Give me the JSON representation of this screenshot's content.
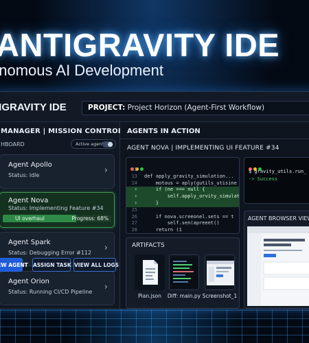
{
  "hero": {
    "title": "ANTIGRAVITY IDE",
    "subtitle": "onomous AI Development"
  },
  "ide": {
    "logo": "TIGRAVITY IDE",
    "project_label": "PROJECT:",
    "project_value": "Project Horizon (Agent-First Workflow)"
  },
  "left_panel": {
    "title": "MANAGER | MISSION CONTROL",
    "subtitle": "HBOARD",
    "toggle_label": "Active agents",
    "agents": [
      {
        "name": "Agent Apollo",
        "status": "Status: Idle"
      },
      {
        "name": "Agent Nova",
        "status": "Status: Implementing Feature #34",
        "task": "UI overhaul",
        "progress_label": "Progress: 68%",
        "progress": 0.68
      },
      {
        "name": "Agent Spark",
        "status": "Status: Debugging Error #112"
      },
      {
        "name": "Agent Orion",
        "status": "Status: Running CI/CD Pipeline"
      }
    ],
    "buttons": {
      "new_agent": "NEW AGENT",
      "assign_task": "ASSIGN TASK",
      "view_logs": "VIEW ALL LOGS"
    }
  },
  "right_panel": {
    "title": "AGENTS IN ACTION",
    "nova_title": "AGENT NOVA | IMPLEMENTING UI FEATURE #34",
    "code": [
      {
        "ln": "22",
        "mark": "",
        "text": ""
      },
      {
        "ln": "13",
        "mark": "",
        "text": "def apply_gravity_simulation..."
      },
      {
        "ln": "14",
        "mark": "",
        "text": "    motous = aply(gutils_utisine"
      },
      {
        "ln": "+",
        "mark": "add",
        "text": "    if (ne === null {"
      },
      {
        "ln": "+",
        "mark": "add",
        "text": "        self.apply_orvity_simulat"
      },
      {
        "ln": "+",
        "mark": "add",
        "text": "    }"
      },
      {
        "ln": "25",
        "mark": "",
        "text": ""
      },
      {
        "ln": "26",
        "mark": "",
        "text": "    if nova.screeonel.sets == t"
      },
      {
        "ln": "27",
        "mark": "",
        "text": "        self.sen(apreeet()"
      },
      {
        "ln": "28",
        "mark": "",
        "text": "    return (1"
      }
    ],
    "terminal": {
      "command": "$ gravity_utils.run_",
      "result": "-> Success"
    },
    "artifacts_title": "ARTIFACTS",
    "artifacts": [
      {
        "name": "Plan.json",
        "icon": "document-icon"
      },
      {
        "name": "Diff: main.py",
        "icon": "code-diff-icon"
      },
      {
        "name": "Screenshot_1",
        "icon": "screenshot-icon"
      }
    ],
    "browser_title": "AGENT BROWSER VIEW"
  },
  "colors": {
    "accent_blue": "#2c6ce8",
    "active_green": "#3f9a57",
    "diff_add": "#1d4a2a",
    "terminal_success": "#4fd176"
  }
}
